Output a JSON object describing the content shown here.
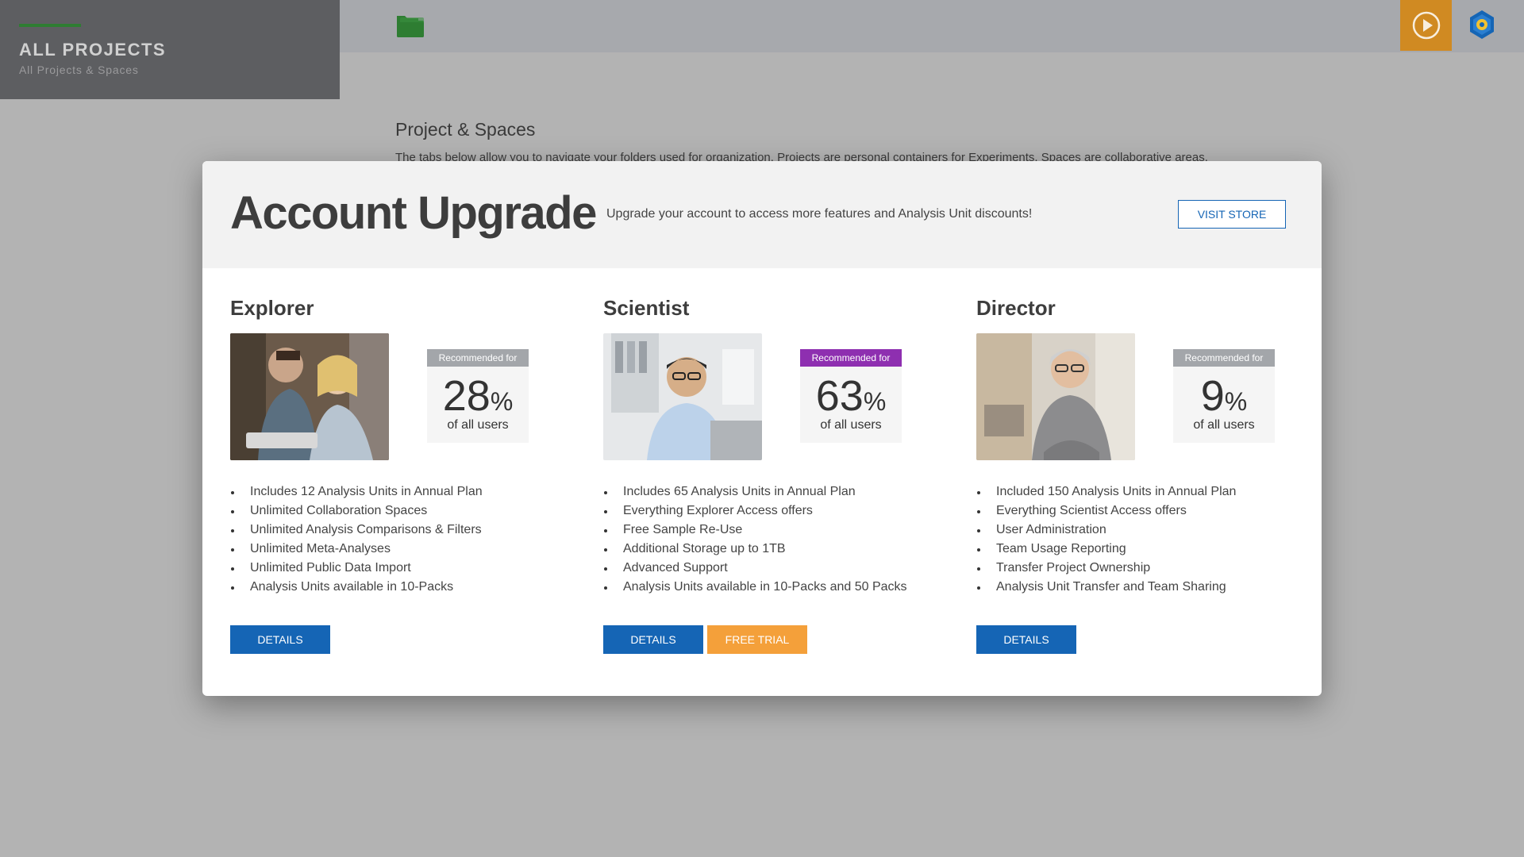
{
  "sidebar": {
    "title": "ALL PROJECTS",
    "subtitle": "All Projects & Spaces"
  },
  "topbar": {
    "folder_icon": "folder-icon",
    "play_icon": "play-circle-icon",
    "logo_icon": "app-logo-icon"
  },
  "background": {
    "heading": "Project & Spaces",
    "text": "The tabs below allow you to navigate your folders used for organization. Projects are personal containers for Experiments. Spaces are collaborative areas."
  },
  "modal": {
    "title": "Account Upgrade",
    "description": "Upgrade your account to access more features and Analysis Unit discounts!",
    "visit_store": "VISIT STORE"
  },
  "plans": [
    {
      "name": "Explorer",
      "badge": "Recommended for",
      "badge_color": "#a3a6aa",
      "percent": "28",
      "percent_sign": "%",
      "sub": "of all users",
      "features": [
        "Includes 12 Analysis Units in Annual Plan",
        "Unlimited Collaboration Spaces",
        "Unlimited Analysis Comparisons & Filters",
        "Unlimited Meta-Analyses",
        "Unlimited Public Data Import",
        "Analysis Units available in 10-Packs"
      ],
      "details": "DETAILS"
    },
    {
      "name": "Scientist",
      "badge": "Recommended for",
      "badge_color": "#8e2fb0",
      "percent": "63",
      "percent_sign": "%",
      "sub": "of all users",
      "features": [
        "Includes 65 Analysis Units in Annual Plan",
        "Everything Explorer Access offers",
        "Free Sample Re-Use",
        "Additional Storage up to 1TB",
        "Advanced Support",
        "Analysis Units available in 10-Packs and 50 Packs"
      ],
      "details": "DETAILS",
      "trial": "FREE TRIAL"
    },
    {
      "name": "Director",
      "badge": "Recommended for",
      "badge_color": "#a3a6aa",
      "percent": "9",
      "percent_sign": "%",
      "sub": "of all users",
      "features": [
        "Included 150 Analysis Units in Annual Plan",
        "Everything Scientist Access offers",
        "User Administration",
        "Team Usage Reporting",
        "Transfer Project Ownership",
        "Analysis Unit Transfer and Team Sharing"
      ],
      "details": "DETAILS"
    }
  ]
}
